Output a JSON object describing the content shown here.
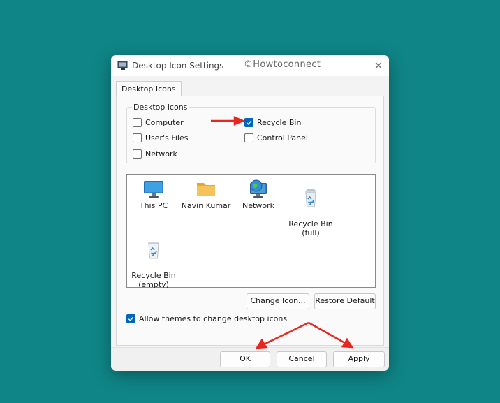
{
  "window": {
    "title": "Desktop Icon Settings",
    "watermark": "©Howtoconnect",
    "close_glyph": "✕"
  },
  "tabs": [
    {
      "label": "Desktop Icons",
      "selected": true
    }
  ],
  "desktop_icons_group": {
    "label": "Desktop icons",
    "options": [
      {
        "label": "Computer",
        "checked": false
      },
      {
        "label": "User's Files",
        "checked": false
      },
      {
        "label": "Network",
        "checked": false
      },
      {
        "label": "Recycle Bin",
        "checked": true
      },
      {
        "label": "Control Panel",
        "checked": false
      }
    ]
  },
  "icon_list": [
    {
      "label": "This PC",
      "icon": "monitor-icon"
    },
    {
      "label": "Navin Kumar",
      "icon": "folder-icon"
    },
    {
      "label": "Network",
      "icon": "network-globe-icon"
    },
    {
      "label": "Recycle Bin\n(full)",
      "icon": "recycle-bin-full-icon"
    },
    {
      "label": "Recycle Bin\n(empty)",
      "icon": "recycle-bin-empty-icon"
    }
  ],
  "buttons": {
    "change_icon": "Change Icon...",
    "restore_default": "Restore Default",
    "ok": "OK",
    "cancel": "Cancel",
    "apply": "Apply"
  },
  "allow_themes": {
    "label": "Allow themes to change desktop icons",
    "checked": true
  },
  "colors": {
    "accent": "#0067c0",
    "background": "#0f8587",
    "annotation_arrow": "#e8251e"
  }
}
